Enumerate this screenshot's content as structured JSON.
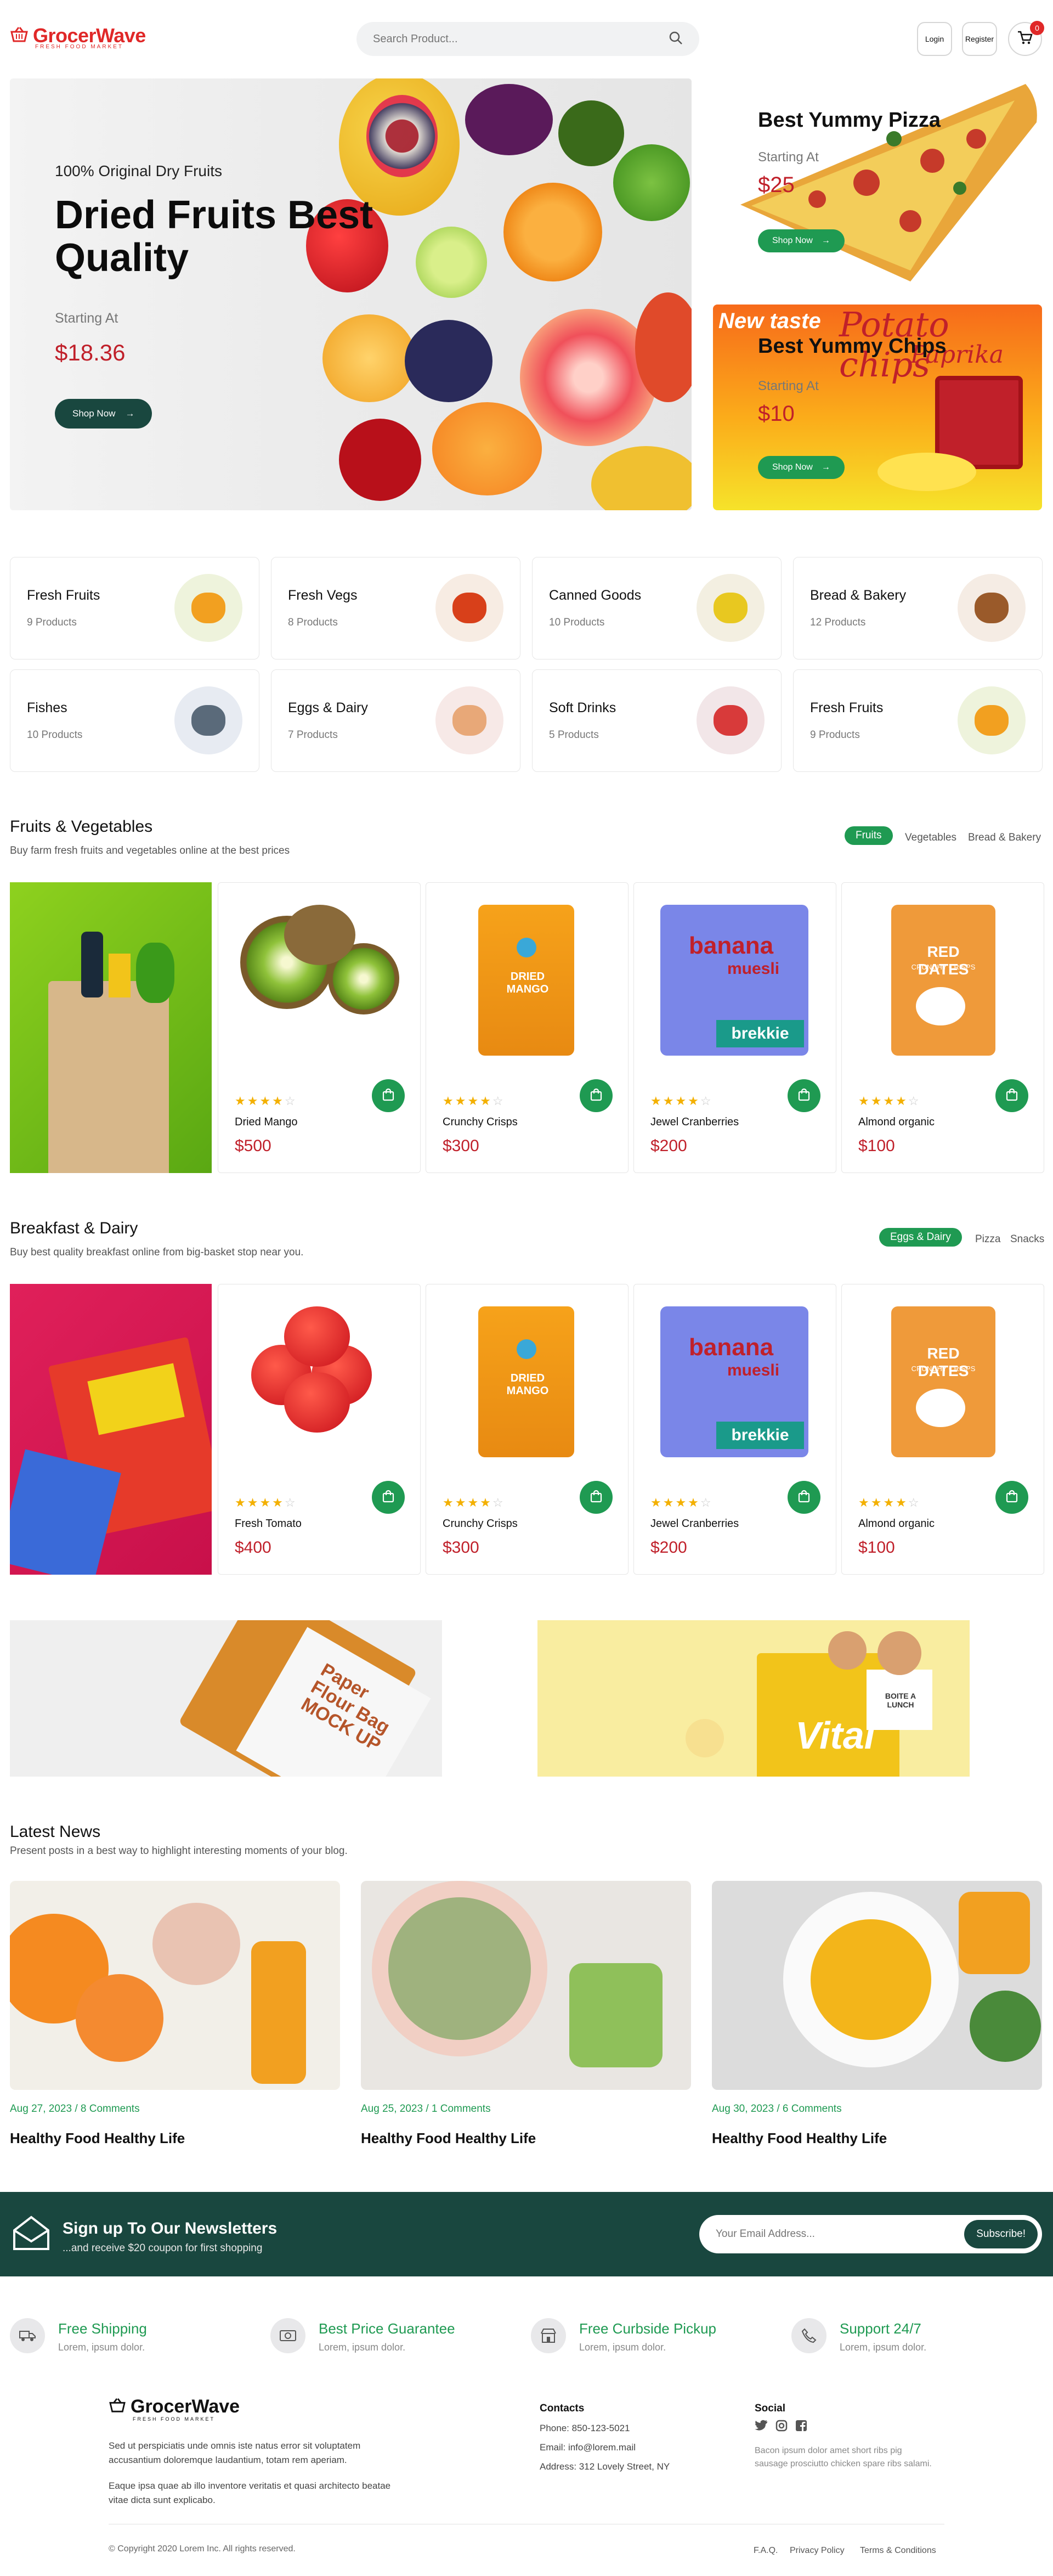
{
  "header": {
    "brand": "GrocerWave",
    "tagline": "FRESH FOOD MARKET",
    "search_placeholder": "Search Product...",
    "login": "Login",
    "register": "Register",
    "cart_count": "0"
  },
  "hero": {
    "subtitle": "100% Original Dry Fruits",
    "title": "Dried Fruits Best Quality",
    "starting_label": "Starting At",
    "price": "$18.36",
    "button": "Shop Now"
  },
  "promo1": {
    "title": "Best Yummy Pizza",
    "starting_label": "Starting At",
    "price": "$25",
    "button": "Shop Now"
  },
  "promo2": {
    "title": "Best Yummy Chips",
    "starting_label": "Starting At",
    "price": "$10",
    "button": "Shop Now",
    "pack_text1": "New taste",
    "pack_text2": "Potato chips",
    "pack_text3": "Paprika"
  },
  "categories": [
    {
      "name": "Fresh Fruits",
      "count": "9 Products"
    },
    {
      "name": "Fresh Vegs",
      "count": "8 Products"
    },
    {
      "name": "Canned Goods",
      "count": "10 Products"
    },
    {
      "name": "Bread & Bakery",
      "count": "12 Products"
    },
    {
      "name": "Fishes",
      "count": "10 Products"
    },
    {
      "name": "Eggs & Dairy",
      "count": "7 Products"
    },
    {
      "name": "Soft Drinks",
      "count": "5 Products"
    },
    {
      "name": "Fresh Fruits",
      "count": "9 Products"
    }
  ],
  "fruits_section": {
    "title": "Fruits & Vegetables",
    "subtitle": "Buy farm fresh fruits and vegetables online at the best prices",
    "tabs": [
      "Fruits",
      "Vegetables",
      "Bread & Bakery"
    ],
    "products": [
      {
        "name": "Dried Mango",
        "price": "$500"
      },
      {
        "name": "Crunchy Crisps",
        "price": "$300"
      },
      {
        "name": "Jewel Cranberries",
        "price": "$200"
      },
      {
        "name": "Almond organic",
        "price": "$100"
      }
    ]
  },
  "breakfast_section": {
    "title": "Breakfast & Dairy",
    "subtitle": "Buy best quality breakfast online from big-basket stop near you.",
    "tabs": [
      "Eggs & Dairy",
      "Pizza",
      "Snacks"
    ],
    "products": [
      {
        "name": "Fresh Tomato",
        "price": "$400"
      },
      {
        "name": "Crunchy Crisps",
        "price": "$300"
      },
      {
        "name": "Jewel Cranberries",
        "price": "$200"
      },
      {
        "name": "Almond organic",
        "price": "$100"
      }
    ]
  },
  "packs": {
    "mango": "DRIED MANGO",
    "banana1": "banana",
    "banana2": "muesli",
    "banana3": "brekkie",
    "dates1": "RED DATES",
    "dates2": "CRUNCHY CRISPS",
    "flour": "Paper Flour Bag MOCK UP",
    "vital": "Vital",
    "lunch": "BOITE A LUNCH"
  },
  "rating": {
    "filled": 4,
    "total": 5
  },
  "news": {
    "title": "Latest News",
    "subtitle": "Present posts in a best way to highlight interesting moments of your blog.",
    "items": [
      {
        "meta": "Aug 27, 2023 / 8 Comments",
        "title": "Healthy Food Healthy Life"
      },
      {
        "meta": "Aug 25, 2023 / 1 Comments",
        "title": "Healthy Food Healthy Life"
      },
      {
        "meta": "Aug 30, 2023 / 6 Comments",
        "title": "Healthy Food Healthy Life"
      }
    ]
  },
  "newsletter": {
    "title": "Sign up To Our Newsletters",
    "subtitle": "...and receive $20 coupon for first shopping",
    "placeholder": "Your Email Address...",
    "button": "Subscribe!"
  },
  "features": [
    {
      "title": "Free Shipping",
      "text": "Lorem, ipsum dolor."
    },
    {
      "title": "Best Price Guarantee",
      "text": "Lorem, ipsum dolor."
    },
    {
      "title": "Free Curbside Pickup",
      "text": "Lorem, ipsum dolor."
    },
    {
      "title": "Support 24/7",
      "text": "Lorem, ipsum dolor."
    }
  ],
  "footer": {
    "about1": "Sed ut perspiciatis unde omnis iste natus error sit voluptatem accusantium doloremque laudantium, totam rem aperiam.",
    "about2": "Eaque ipsa quae ab illo inventore veritatis et quasi architecto beatae vitae dicta sunt explicabo.",
    "contacts_title": "Contacts",
    "phone": "Phone: 850-123-5021",
    "email": "Email: info@lorem.mail",
    "address": "Address: 312 Lovely Street, NY",
    "social_title": "Social",
    "social_text": "Bacon ipsum dolor amet short ribs pig sausage prosciutto chicken spare ribs salami.",
    "copyright": "© Copyright 2020 Lorem Inc. All rights reserved.",
    "links": [
      "F.A.Q.",
      "Privacy Policy",
      "Terms & Conditions"
    ]
  },
  "colors": {
    "brand_red": "#e02828",
    "green": "#1f9a52",
    "dark_green": "#19473f",
    "price_red": "#c0202a",
    "star": "#f3b000"
  }
}
